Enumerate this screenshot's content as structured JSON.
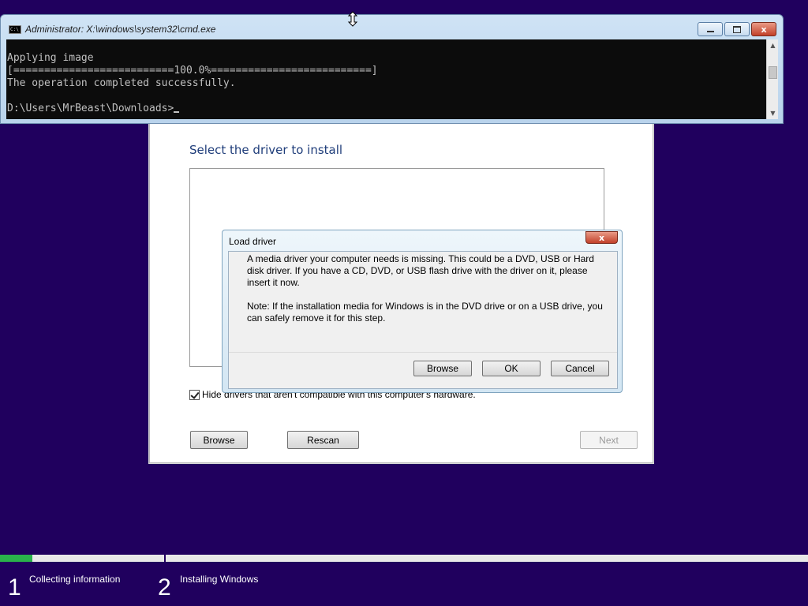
{
  "cmd": {
    "title": "Administrator: X:\\windows\\system32\\cmd.exe",
    "icon_text": "C:\\",
    "lines": [
      "Applying image",
      "[==========================100.0%==========================]",
      "The operation completed successfully.",
      "",
      "D:\\Users\\MrBeast\\Downloads>"
    ],
    "close_glyph": "x"
  },
  "setup": {
    "title": "Select the driver to install",
    "hide_incompatible_label": "Hide drivers that aren't compatible with this computer's hardware.",
    "hide_incompatible_checked": true,
    "browse_label": "Browse",
    "rescan_label": "Rescan",
    "next_label": "Next"
  },
  "dialog": {
    "title": "Load driver",
    "message1": "A media driver your computer needs is missing. This could be a DVD, USB or Hard disk driver. If you have a CD, DVD, or USB flash drive with the driver on it, please insert it now.",
    "message2": "Note: If the installation media for Windows is in the DVD drive or on a USB drive, you can safely remove it for this step.",
    "browse_label": "Browse",
    "ok_label": "OK",
    "cancel_label": "Cancel",
    "close_glyph": "x"
  },
  "progress": {
    "fraction": 0.04,
    "steps": [
      {
        "number": "1",
        "label": "Collecting information"
      },
      {
        "number": "2",
        "label": "Installing Windows"
      }
    ]
  },
  "colors": {
    "background": "#20005e",
    "progress_fill": "#2ab24b",
    "setup_title": "#1f3d7a"
  }
}
